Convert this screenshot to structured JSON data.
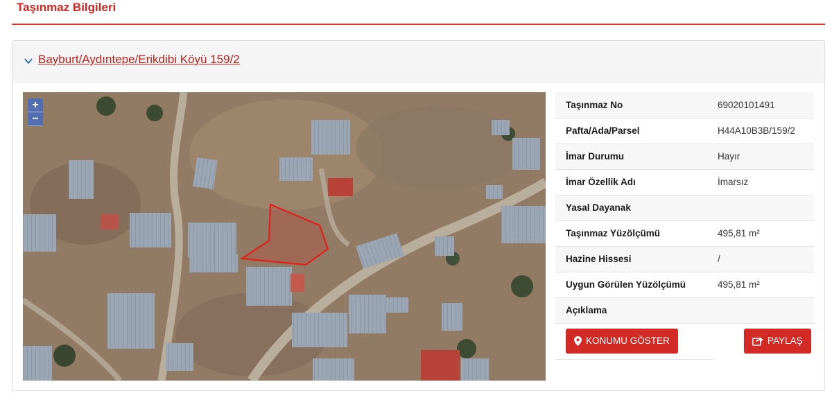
{
  "page": {
    "title": "Taşınmaz Bilgileri"
  },
  "property": {
    "heading": "Bayburt/Aydıntepe/Erikdibi Köyü 159/2"
  },
  "map": {
    "zoom_in": "+",
    "zoom_out": "−",
    "parcel_color": "#e0201c"
  },
  "details": [
    {
      "label": "Taşınmaz No",
      "value": "69020101491"
    },
    {
      "label": "Pafta/Ada/Parsel",
      "value": "H44A10B3B/159/2"
    },
    {
      "label": "İmar Durumu",
      "value": "Hayır"
    },
    {
      "label": "İmar Özellik Adı",
      "value": "İmarsız"
    },
    {
      "label": "Yasal Dayanak",
      "value": ""
    },
    {
      "label": "Taşınmaz Yüzölçümü",
      "value": "495,81 m²"
    },
    {
      "label": "Hazine Hissesi",
      "value": "/"
    },
    {
      "label": "Uygun Görülen Yüzölçümü",
      "value": "495,81 m²"
    },
    {
      "label": "Açıklama",
      "value": ""
    }
  ],
  "buttons": {
    "show_location": "KONUMU GÖSTER",
    "share": "PAYLAŞ"
  },
  "colors": {
    "accent": "#d42a25",
    "header_line": "#e3342f"
  }
}
